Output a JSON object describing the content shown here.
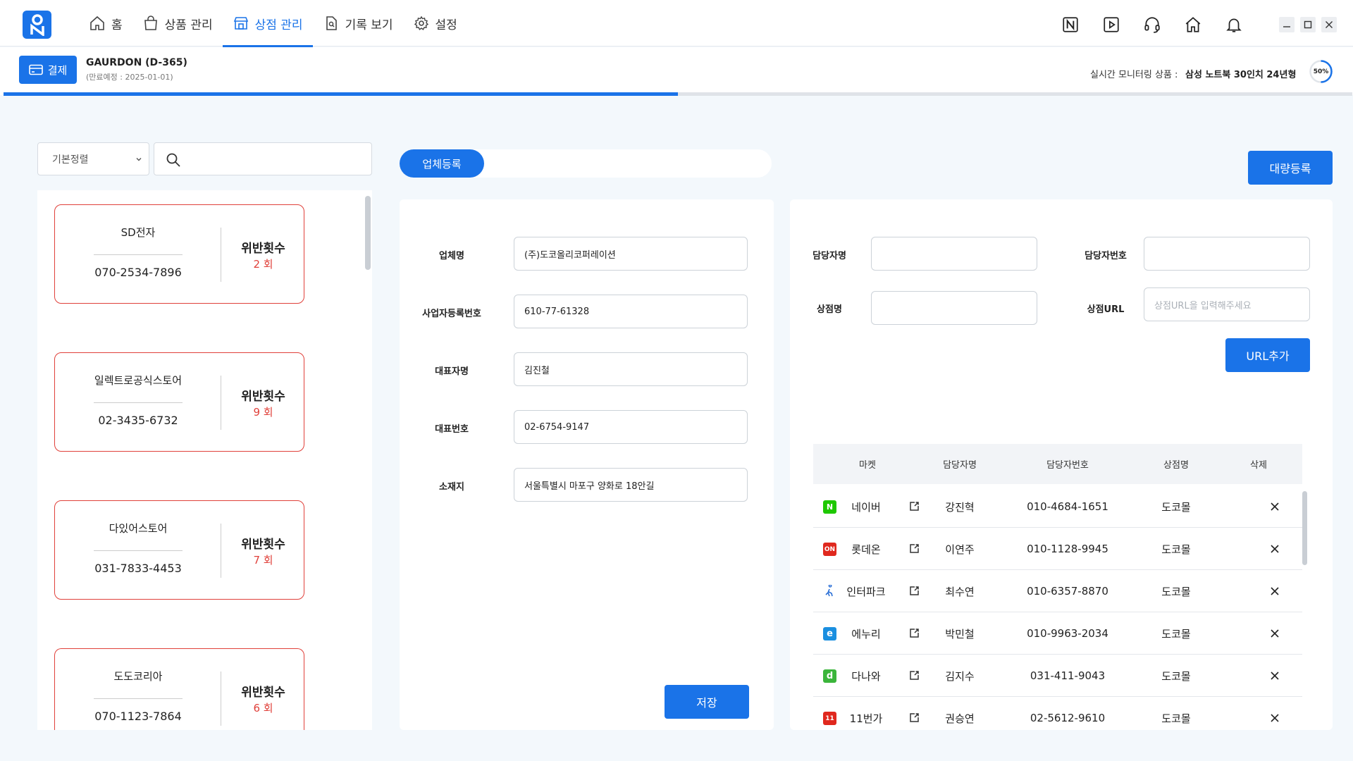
{
  "nav": {
    "items": [
      {
        "label": "홈",
        "icon": "home-icon"
      },
      {
        "label": "상품 관리",
        "icon": "shopping-bag-icon"
      },
      {
        "label": "상점 관리",
        "icon": "store-icon",
        "active": true
      },
      {
        "label": "기록 보기",
        "icon": "document-search-icon"
      },
      {
        "label": "설정",
        "icon": "gear-icon"
      }
    ],
    "right_icons": [
      "naver-n-icon",
      "play-icon",
      "headset-icon",
      "home-icon",
      "bell-icon"
    ]
  },
  "subheader": {
    "pay_label": "결제",
    "plan_name": "GAURDON (D-365)",
    "plan_expiry": "(만료예정 : 2025-01-01)",
    "monitor_label": "실시간 모니터링 상품  :",
    "monitor_value": "삼성 노트북 30인치 24년형",
    "progress_text": "50%",
    "progress": 0.5
  },
  "left": {
    "sort_value": "기본정렬",
    "search_placeholder": "",
    "cards": [
      {
        "name": "SD전자",
        "phone": "070-2534-7896",
        "violation_label": "위반횟수",
        "count": "2 회"
      },
      {
        "name": "일렉트로공식스토어",
        "phone": "02-3435-6732",
        "violation_label": "위반횟수",
        "count": "9 회"
      },
      {
        "name": "다있어스토어",
        "phone": "031-7833-4453",
        "violation_label": "위반횟수",
        "count": "7 회"
      },
      {
        "name": "도도코리아",
        "phone": "070-1123-7864",
        "violation_label": "위반횟수",
        "count": "6 회"
      }
    ]
  },
  "middle": {
    "tab_label": "업체등록",
    "bulk_label": "대량등록",
    "fields": [
      {
        "label": "업체명",
        "value": "(주)도코올리코퍼레이션"
      },
      {
        "label": "사업자등록번호",
        "value": "610-77-61328"
      },
      {
        "label": "대표자명",
        "value": "김진철"
      },
      {
        "label": "대표번호",
        "value": "02-6754-9147"
      },
      {
        "label": "소재지",
        "value": "서울특별시 마포구 양화로 18안길"
      }
    ],
    "save_label": "저장"
  },
  "right": {
    "manager_label": "담당자명",
    "manager_phone_label": "담당자번호",
    "store_label": "상점명",
    "store_url_label": "상점URL",
    "store_url_placeholder": "상점URL을 입력해주세요",
    "url_add_label": "URL추가",
    "table": {
      "headers": [
        "마켓",
        "담당자명",
        "담당자번호",
        "상점명",
        "삭제"
      ],
      "rows": [
        {
          "market": "네이버",
          "icon": "naver-icon",
          "color": "#1ec800",
          "glyph": "N",
          "manager": "강진혁",
          "phone": "010-4684-1651",
          "store": "도코몰"
        },
        {
          "market": "롯데온",
          "icon": "lotteon-icon",
          "color": "#e0281e",
          "glyph": "ON",
          "manager": "이연주",
          "phone": "010-1128-9945",
          "store": "도코몰"
        },
        {
          "market": "인터파크",
          "icon": "interpark-icon",
          "color": "#ffffff",
          "glyph": "",
          "manager": "최수연",
          "phone": "010-6357-8870",
          "store": "도코몰"
        },
        {
          "market": "에누리",
          "icon": "enuri-icon",
          "color": "#1a8fe0",
          "glyph": "e",
          "manager": "박민철",
          "phone": "010-9963-2034",
          "store": "도코몰"
        },
        {
          "market": "다나와",
          "icon": "danawa-icon",
          "color": "#3bb53b",
          "glyph": "d",
          "manager": "김지수",
          "phone": "031-411-9043",
          "store": "도코몰"
        },
        {
          "market": "11번가",
          "icon": "11st-icon",
          "color": "#e0281e",
          "glyph": "11",
          "manager": "권승연",
          "phone": "02-5612-9610",
          "store": "도코몰"
        }
      ]
    }
  }
}
